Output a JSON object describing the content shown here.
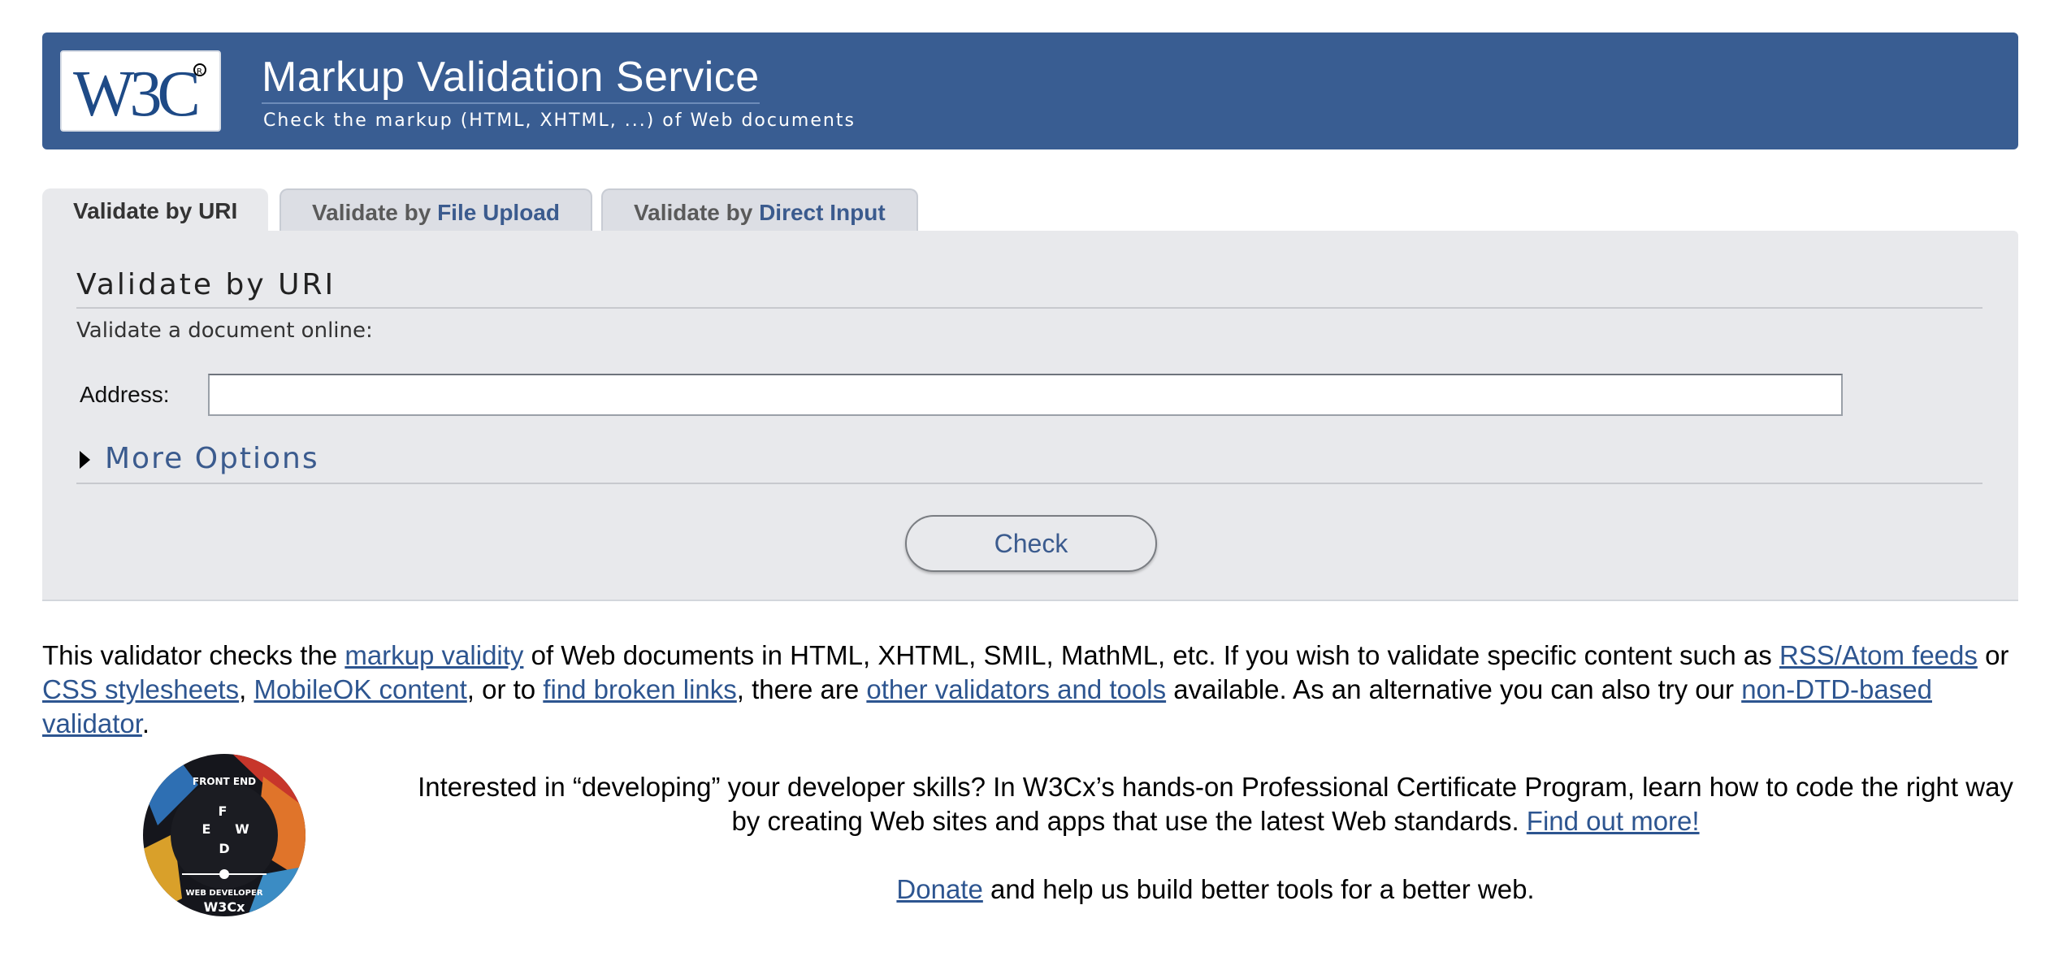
{
  "header": {
    "logo_text": "W3C",
    "title": "Markup Validation Service",
    "subtitle": "Check the markup (HTML, XHTML, ...) of Web documents"
  },
  "tabs": [
    {
      "prefix": "Validate by ",
      "highlight": "URI",
      "active": true
    },
    {
      "prefix": "Validate by ",
      "highlight": "File Upload",
      "active": false
    },
    {
      "prefix": "Validate by ",
      "highlight": "Direct Input",
      "active": false
    }
  ],
  "panel": {
    "heading": "Validate by URI",
    "description": "Validate a document online:",
    "address_label": "Address:",
    "address_value": "",
    "more_options": "More Options",
    "check_button": "Check"
  },
  "intro": {
    "t1": "This validator checks the ",
    "l1": "markup validity",
    "t2": " of Web documents in HTML, XHTML, SMIL, MathML, etc. If you wish to validate specific content such as ",
    "l2": "RSS/Atom feeds",
    "t3": " or ",
    "l3": "CSS stylesheets",
    "t4": ", ",
    "l4": "MobileOK content",
    "t5": ", or to ",
    "l5": "find broken links",
    "t6": ", there are ",
    "l6": "other validators and tools",
    "t7": " available. As an alternative you can also try our ",
    "l7": "non-DTD-based validator",
    "t8": "."
  },
  "promo": {
    "badge_texts": [
      "FRONT END",
      "WEB DEVELOPER",
      "F",
      "E",
      "W",
      "D",
      "W3Cx"
    ],
    "text": "Interested in “developing” your developer skills? In W3Cx’s hands-on Professional Certificate Program, learn how to code the right way by creating Web sites and apps that use the latest Web standards. ",
    "link": "Find out more!"
  },
  "donate": {
    "link": "Donate",
    "text": " and help us build better tools for a better web."
  },
  "colors": {
    "banner": "#395d92",
    "panel": "#e8e9ec",
    "link": "#2d5590"
  }
}
